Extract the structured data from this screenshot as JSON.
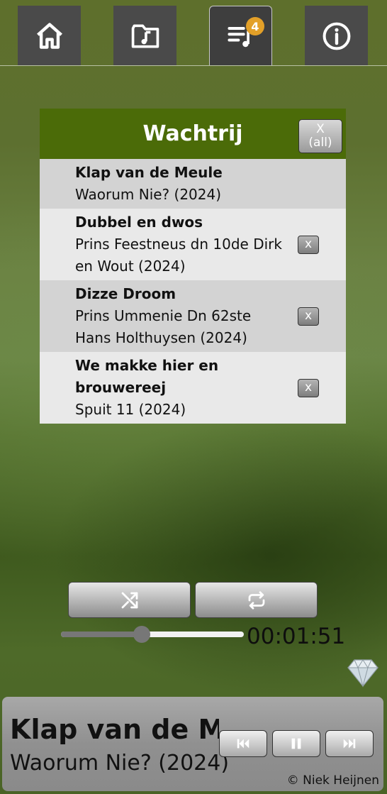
{
  "nav": {
    "queue_count": "4"
  },
  "queue": {
    "title": "Wachtrij",
    "clear_all": [
      "X",
      "(all)"
    ],
    "items": [
      {
        "title": "Klap van de Meule",
        "artist": "Waorum Nie? (2024)",
        "remove": ""
      },
      {
        "title": "Dubbel en dwos",
        "artist": "Prins Feestneus dn 10de Dirk en Wout (2024)",
        "remove": "x"
      },
      {
        "title": "Dizze Droom",
        "artist": "Prins Ummenie Dn 62ste Hans Holthuysen (2024)",
        "remove": "x"
      },
      {
        "title": "We makke hier en brouwereej",
        "artist": "Spuit 11 (2024)",
        "remove": "x"
      }
    ]
  },
  "player": {
    "time": "00:01:51",
    "progress_fraction": 0.44,
    "now_playing_title": "Klap van de Meule",
    "now_playing_artist": "Waorum Nie? (2024)",
    "copyright": "© Niek Heijnen"
  },
  "colors": {
    "header_green": "#4b6b08",
    "badge": "#e3a028"
  },
  "icons": [
    "home-icon",
    "music-folder-icon",
    "queue-music-icon",
    "info-icon",
    "shuffle-icon",
    "repeat-icon",
    "diamond-icon",
    "previous-icon",
    "pause-icon",
    "next-icon"
  ]
}
